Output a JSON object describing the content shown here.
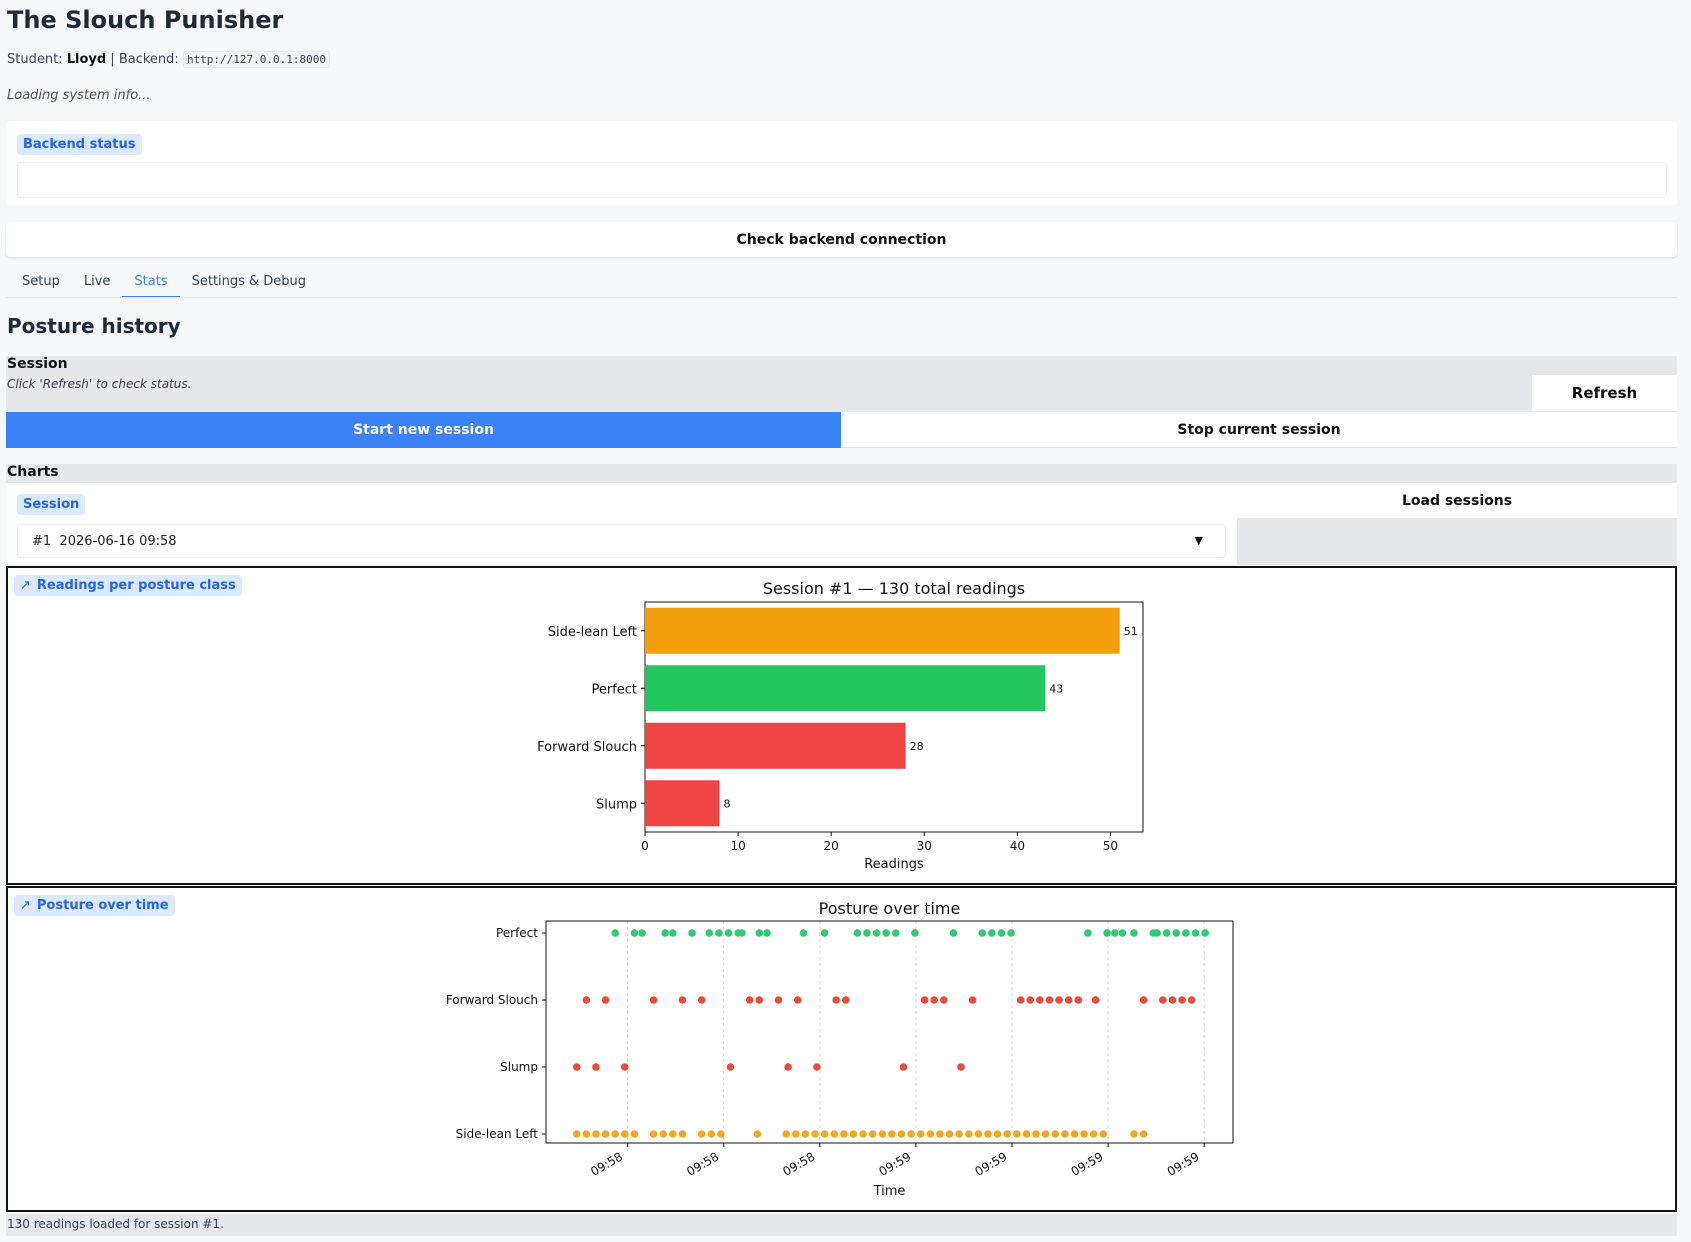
{
  "app": {
    "title": "The Slouch Punisher",
    "student_label": "Student:",
    "student_name": "Lloyd",
    "separator": "|",
    "backend_label": "Backend:",
    "backend_url": "http://127.0.0.1:8000",
    "loading_text": "Loading system info..."
  },
  "status": {
    "badge": "Backend status",
    "check_button": "Check backend connection"
  },
  "tabs": [
    {
      "label": "Setup"
    },
    {
      "label": "Live"
    },
    {
      "label": "Stats",
      "active": true
    },
    {
      "label": "Settings & Debug"
    }
  ],
  "history": {
    "heading": "Posture history",
    "session_label": "Session",
    "session_hint": "Click 'Refresh' to check status.",
    "refresh_button": "Refresh",
    "start_button": "Start new session",
    "stop_button": "Stop current session"
  },
  "charts_section": {
    "label": "Charts",
    "session_badge": "Session",
    "session_selected": "#1  2026-06-16 09:58",
    "load_button": "Load sessions",
    "footer": "130 readings loaded for session #1."
  },
  "colors": {
    "accent": "#3b82f6",
    "orange": "#f59e0b",
    "green": "#22c55e",
    "red": "#ef4444",
    "scatter_green": "#2ecc71",
    "scatter_red": "#e74c3c",
    "scatter_orange": "#f5a623"
  },
  "chart_data": [
    {
      "panel_badge": "Readings per posture class",
      "type": "bar",
      "orientation": "horizontal",
      "title": "Session #1 — 130 total readings",
      "xlabel": "Readings",
      "ylabel": "",
      "categories": [
        "Side-lean Left",
        "Perfect",
        "Forward Slouch",
        "Slump"
      ],
      "values": [
        51,
        43,
        28,
        8
      ],
      "bar_colors": [
        "#f59e0b",
        "#22c55e",
        "#ef4444",
        "#ef4444"
      ],
      "xlim": [
        0,
        53.5
      ],
      "xticks": [
        "0",
        "10",
        "20",
        "30",
        "40",
        "50"
      ],
      "grid": false
    },
    {
      "panel_badge": "Posture over time",
      "type": "scatter",
      "title": "Posture over time",
      "xlabel": "Time",
      "ylabel": "",
      "categories": [
        "Side-lean Left",
        "Slump",
        "Forward Slouch",
        "Perfect"
      ],
      "xticks": [
        "09:58",
        "09:58",
        "09:58",
        "09:59",
        "09:59",
        "09:59",
        "09:59"
      ],
      "xtick_positions": [
        8.5,
        18.5,
        28.5,
        38.5,
        48.5,
        58.5,
        68.5
      ],
      "xlim": [
        0,
        71.5
      ],
      "grid": "vertical",
      "series": [
        {
          "category": "Perfect",
          "x": [
            7.2,
            9.2,
            10,
            12.4,
            13.2,
            15.2,
            17,
            18,
            19,
            20,
            20.4,
            22.2,
            23,
            26.8,
            29,
            32.4,
            33.4,
            34.4,
            35.4,
            36.4,
            38.4,
            42.4,
            45.4,
            46.4,
            47.4,
            48.4,
            56.4,
            58.4,
            59.2,
            60,
            61.2,
            63.2,
            63.6,
            64.6,
            65.6,
            66.6,
            67.6,
            68.6
          ]
        },
        {
          "category": "Forward Slouch",
          "x": [
            4.2,
            6.2,
            11.2,
            14.2,
            16.2,
            21.2,
            22.2,
            24.2,
            26.2,
            30.2,
            31.2,
            39.4,
            40.4,
            41.4,
            44.4,
            49.4,
            50.4,
            51.4,
            52.4,
            53.4,
            54.4,
            55.4,
            57.2,
            62.2,
            64.2,
            65.2,
            66.2,
            67.2
          ]
        },
        {
          "category": "Slump",
          "x": [
            3.2,
            5.2,
            8.2,
            19.2,
            25.2,
            28.2,
            37.2,
            43.2
          ]
        },
        {
          "category": "Side-lean Left",
          "x": [
            3.2,
            4.2,
            5.2,
            6.2,
            7.2,
            8.2,
            9.2,
            11.2,
            12.2,
            13.2,
            14.2,
            16.2,
            17.2,
            18.2,
            22,
            25,
            26,
            27,
            28,
            29,
            30,
            31,
            32,
            33,
            34,
            35,
            36,
            37,
            38,
            39,
            40,
            41,
            42,
            43,
            44,
            45,
            46,
            47,
            48,
            49,
            50,
            51,
            52,
            53,
            54,
            55,
            56,
            57,
            58,
            61.2,
            62.2
          ]
        }
      ]
    }
  ]
}
